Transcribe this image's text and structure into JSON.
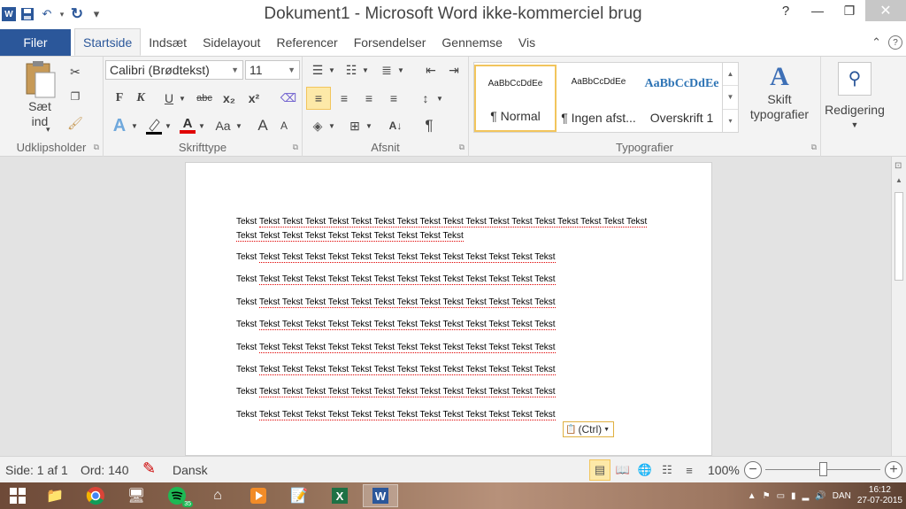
{
  "window": {
    "title": "Dokument1 - Microsoft Word ikke-kommerciel brug",
    "app_logo": "W",
    "minimize": "—",
    "restore": "❐",
    "close": "✕"
  },
  "qat": {
    "save_icon": "💾",
    "undo_icon": "↶",
    "redo_icon": "↻",
    "customize_icon": "▾"
  },
  "tabs": {
    "file": "Filer",
    "items": [
      "Startside",
      "Indsæt",
      "Sidelayout",
      "Referencer",
      "Forsendelser",
      "Gennemse",
      "Vis"
    ],
    "active_index": 0,
    "collapse_icon": "⌃",
    "help_icon": "?"
  },
  "ribbon": {
    "clipboard": {
      "label": "Udklipsholder",
      "paste": "Sæt ind",
      "paste_arrow": "▾"
    },
    "font": {
      "label": "Skrifttype",
      "font_name": "Calibri (Brødtekst)",
      "font_size": "11",
      "bold": "F",
      "italic": "K",
      "underline": "U",
      "strike": "abc",
      "subscript": "x₂",
      "superscript": "x²",
      "grow": "A",
      "shrink": "A",
      "case": "Aa",
      "font_color": "#e00000"
    },
    "paragraph": {
      "label": "Afsnit",
      "show_marks": "¶"
    },
    "styles": {
      "label": "Typografier",
      "tiles": [
        {
          "preview": "AaBbCcDdEe",
          "name": "¶ Normal"
        },
        {
          "preview": "AaBbCcDdEe",
          "name": "¶ Ingen afst..."
        },
        {
          "preview": "AaBbCcDdEe",
          "name": "Overskrift 1"
        }
      ],
      "change_styles": "Skift typografier"
    },
    "editing": {
      "label": "Redigering"
    }
  },
  "document": {
    "first_line_a": "Tekst",
    "first_line_b": "Tekst Tekst Tekst Tekst Tekst Tekst Tekst Tekst Tekst Tekst Tekst Tekst Tekst Tekst Tekst Tekst Tekst",
    "second_line": "Tekst Tekst Tekst Tekst Tekst Tekst Tekst Tekst Tekst Tekst",
    "para_first": "Tekst",
    "para_rest": "Tekst Tekst Tekst Tekst Tekst Tekst Tekst Tekst Tekst Tekst Tekst Tekst Tekst",
    "paste_options": "(Ctrl)",
    "paste_icon": "📋"
  },
  "status": {
    "page": "Side: 1 af 1",
    "words": "Ord: 140",
    "language": "Dansk",
    "zoom": "100%",
    "zoom_level": 1.0
  },
  "taskbar": {
    "time": "16:12",
    "date": "27-07-2015",
    "keyboard": "DAN",
    "spotify_badge": "35"
  },
  "colors": {
    "accent": "#2b579a",
    "selected_style_border": "#f2c55c",
    "spell_error": "#e00000"
  }
}
